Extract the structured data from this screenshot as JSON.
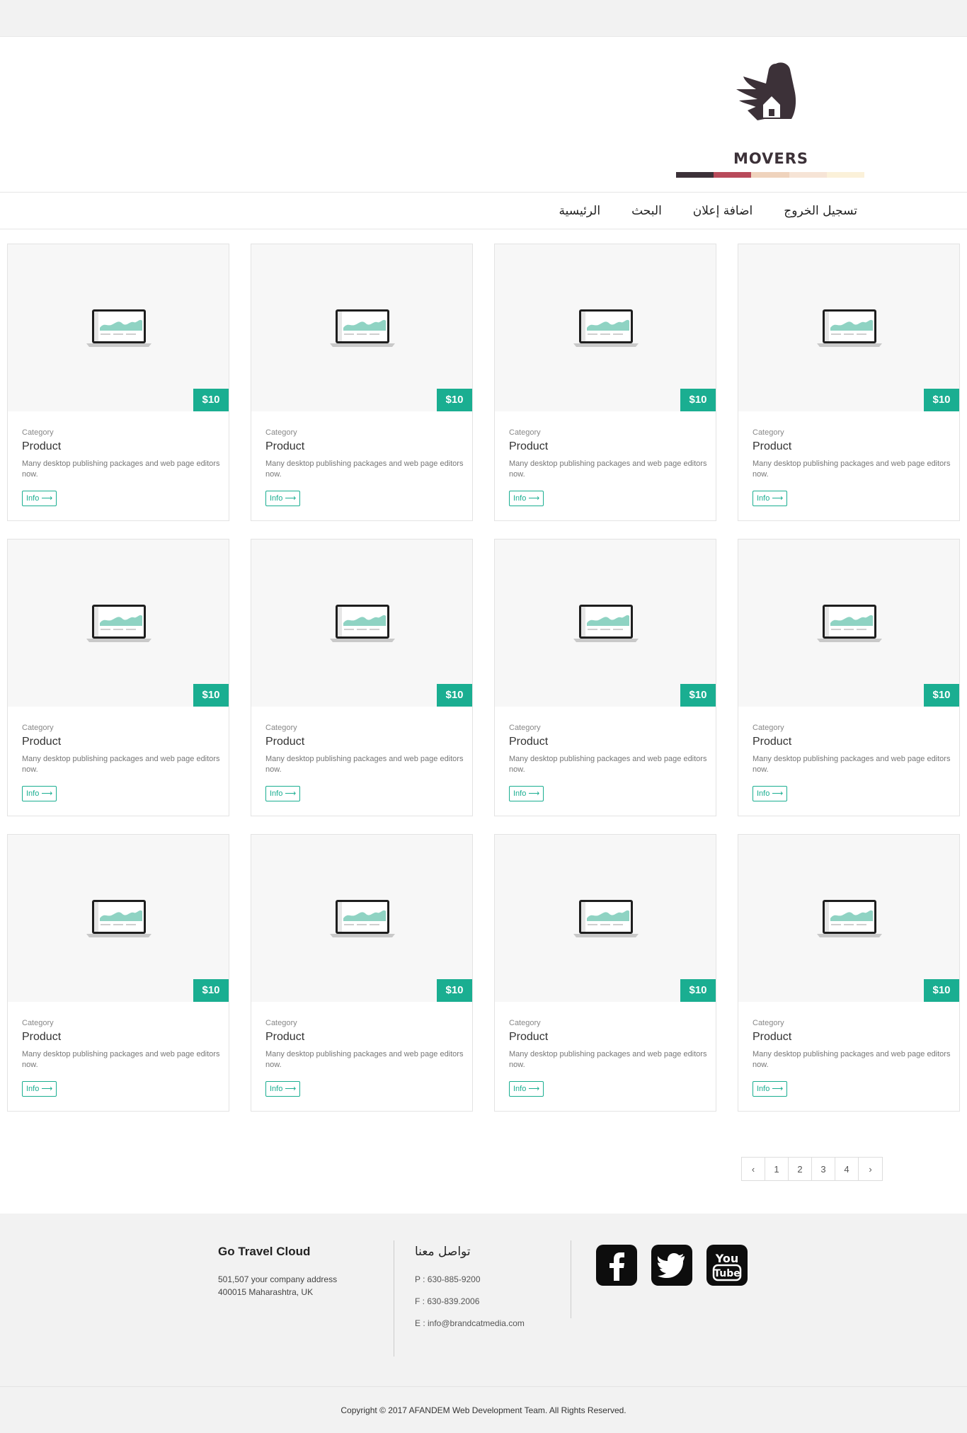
{
  "brand": {
    "logo_text": "MOVERS",
    "colors": [
      "#3c3138",
      "#b84a5a",
      "#efd3bd",
      "#f6e4d6",
      "#fbf1d9"
    ]
  },
  "nav": {
    "items": [
      {
        "label": "الرئيسية"
      },
      {
        "label": "البحث"
      },
      {
        "label": "اضافة إعلان"
      },
      {
        "label": "تسجيل الخروج"
      }
    ]
  },
  "products": [
    {
      "price": "$10",
      "category": "Category",
      "name": "Product",
      "description": "Many desktop publishing packages and web page editors now.",
      "button": "Info ⟶"
    },
    {
      "price": "$10",
      "category": "Category",
      "name": "Product",
      "description": "Many desktop publishing packages and web page editors now.",
      "button": "Info ⟶"
    },
    {
      "price": "$10",
      "category": "Category",
      "name": "Product",
      "description": "Many desktop publishing packages and web page editors now.",
      "button": "Info ⟶"
    },
    {
      "price": "$10",
      "category": "Category",
      "name": "Product",
      "description": "Many desktop publishing packages and web page editors now.",
      "button": "Info ⟶"
    },
    {
      "price": "$10",
      "category": "Category",
      "name": "Product",
      "description": "Many desktop publishing packages and web page editors now.",
      "button": "Info ⟶"
    },
    {
      "price": "$10",
      "category": "Category",
      "name": "Product",
      "description": "Many desktop publishing packages and web page editors now.",
      "button": "Info ⟶"
    },
    {
      "price": "$10",
      "category": "Category",
      "name": "Product",
      "description": "Many desktop publishing packages and web page editors now.",
      "button": "Info ⟶"
    },
    {
      "price": "$10",
      "category": "Category",
      "name": "Product",
      "description": "Many desktop publishing packages and web page editors now.",
      "button": "Info ⟶"
    },
    {
      "price": "$10",
      "category": "Category",
      "name": "Product",
      "description": "Many desktop publishing packages and web page editors now.",
      "button": "Info ⟶"
    },
    {
      "price": "$10",
      "category": "Category",
      "name": "Product",
      "description": "Many desktop publishing packages and web page editors now.",
      "button": "Info ⟶"
    },
    {
      "price": "$10",
      "category": "Category",
      "name": "Product",
      "description": "Many desktop publishing packages and web page editors now.",
      "button": "Info ⟶"
    },
    {
      "price": "$10",
      "category": "Category",
      "name": "Product",
      "description": "Many desktop publishing packages and web page editors now.",
      "button": "Info ⟶"
    }
  ],
  "pagination": {
    "prev": "‹",
    "pages": [
      "1",
      "2",
      "3",
      "4"
    ],
    "next": "›"
  },
  "footer": {
    "company": "Go Travel Cloud",
    "address_line1": "501,507 your company address",
    "address_line2": "400015 Maharashtra, UK",
    "contact_title": "تواصل معنا",
    "phone": "P :  630-885-9200",
    "fax": "F :  630-839.2006",
    "email": "E :  info@brandcatmedia.com",
    "social": [
      "facebook-icon",
      "twitter-icon",
      "youtube-icon"
    ]
  },
  "copyright": "Copyright © 2017 AFANDEM Web Development Team. All Rights Reserved.",
  "accent_color": "#1aae91"
}
